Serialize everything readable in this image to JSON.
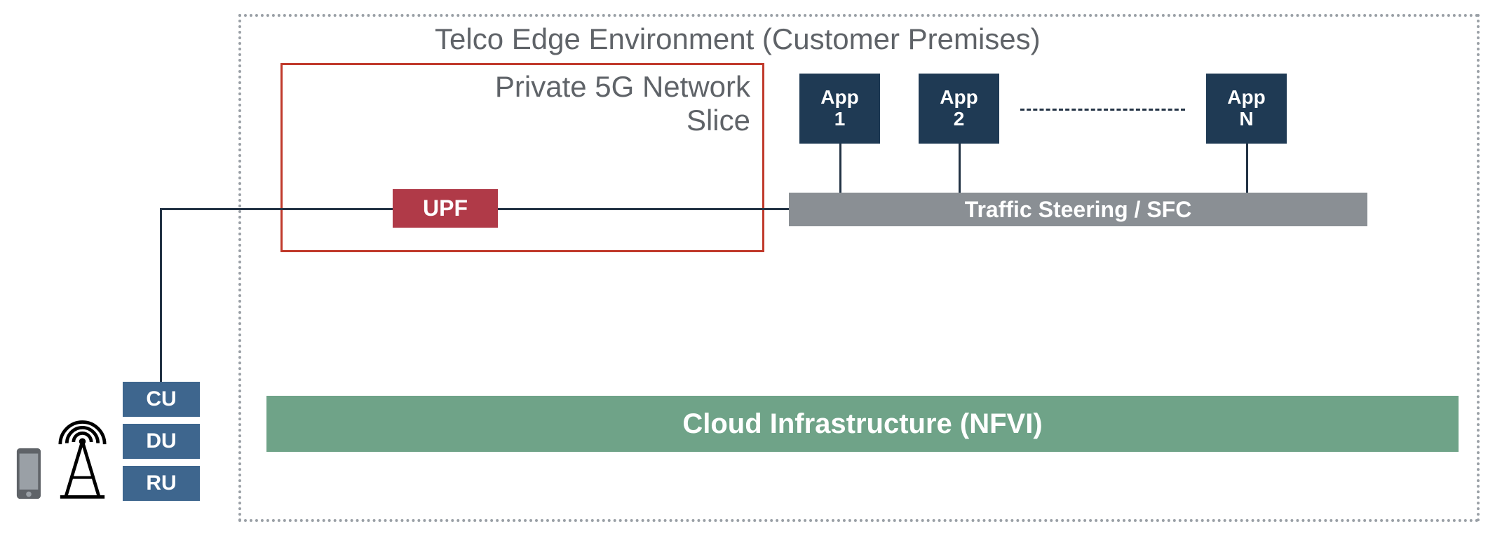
{
  "colors": {
    "dotted_border": "#9aa0a6",
    "slice_border": "#c0392b",
    "upf_bg": "#b03a48",
    "ts_bg": "#8a8f94",
    "app_bg": "#1f3a54",
    "nfvi_bg": "#6fa388",
    "ran_bg": "#3e668e",
    "line": "#223244",
    "title_text": "#5f6368"
  },
  "edgeEnv": {
    "title": "Telco Edge Environment (Customer Premises)"
  },
  "slice": {
    "title": "Private 5G Network\nSlice"
  },
  "upf": {
    "label": "UPF"
  },
  "trafficSteering": {
    "label": "Traffic Steering / SFC"
  },
  "apps": {
    "app1": {
      "line1": "App",
      "line2": "1"
    },
    "app2": {
      "line1": "App",
      "line2": "2"
    },
    "appN": {
      "line1": "App",
      "line2": "N"
    }
  },
  "nfvi": {
    "label": "Cloud Infrastructure (NFVI)"
  },
  "ran": {
    "cu": "CU",
    "du": "DU",
    "ru": "RU"
  }
}
